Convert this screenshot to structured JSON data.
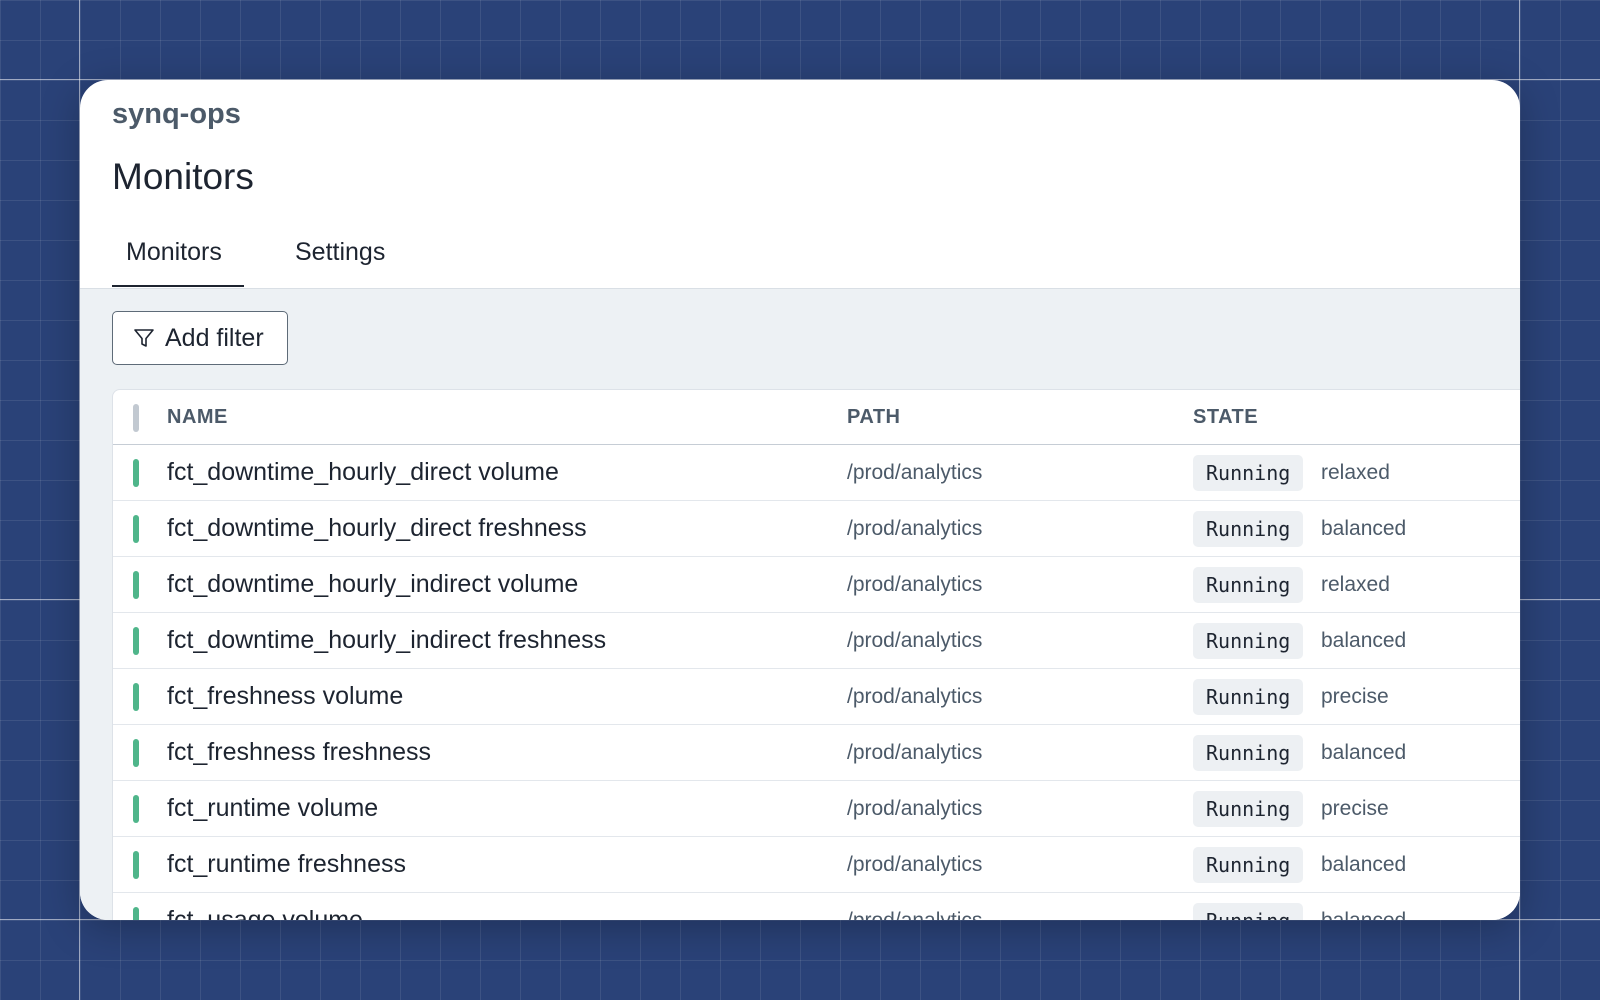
{
  "app": {
    "org_name": "synq-ops",
    "page_title": "Monitors"
  },
  "tabs": [
    {
      "label": "Monitors",
      "active": true
    },
    {
      "label": "Settings",
      "active": false
    }
  ],
  "toolbar": {
    "add_filter_label": "Add filter",
    "filter_icon": "filter-icon"
  },
  "table": {
    "columns": {
      "name": "NAME",
      "path": "PATH",
      "state": "STATE"
    },
    "rows": [
      {
        "name": "fct_downtime_hourly_direct volume",
        "path": "/prod/analytics",
        "state": "Running",
        "mode": "relaxed"
      },
      {
        "name": "fct_downtime_hourly_direct freshness",
        "path": "/prod/analytics",
        "state": "Running",
        "mode": "balanced"
      },
      {
        "name": "fct_downtime_hourly_indirect volume",
        "path": "/prod/analytics",
        "state": "Running",
        "mode": "relaxed"
      },
      {
        "name": "fct_downtime_hourly_indirect freshness",
        "path": "/prod/analytics",
        "state": "Running",
        "mode": "balanced"
      },
      {
        "name": "fct_freshness volume",
        "path": "/prod/analytics",
        "state": "Running",
        "mode": "precise"
      },
      {
        "name": "fct_freshness freshness",
        "path": "/prod/analytics",
        "state": "Running",
        "mode": "balanced"
      },
      {
        "name": "fct_runtime volume",
        "path": "/prod/analytics",
        "state": "Running",
        "mode": "precise"
      },
      {
        "name": "fct_runtime freshness",
        "path": "/prod/analytics",
        "state": "Running",
        "mode": "balanced"
      },
      {
        "name": "fct_usage volume",
        "path": "/prod/analytics",
        "state": "Running",
        "mode": "balanced"
      }
    ]
  },
  "colors": {
    "background": "#2a4278",
    "status_ok": "#4fb58a",
    "status_header": "#c2c9d1",
    "text_primary": "#1d2430",
    "text_secondary": "#4c5a69"
  }
}
